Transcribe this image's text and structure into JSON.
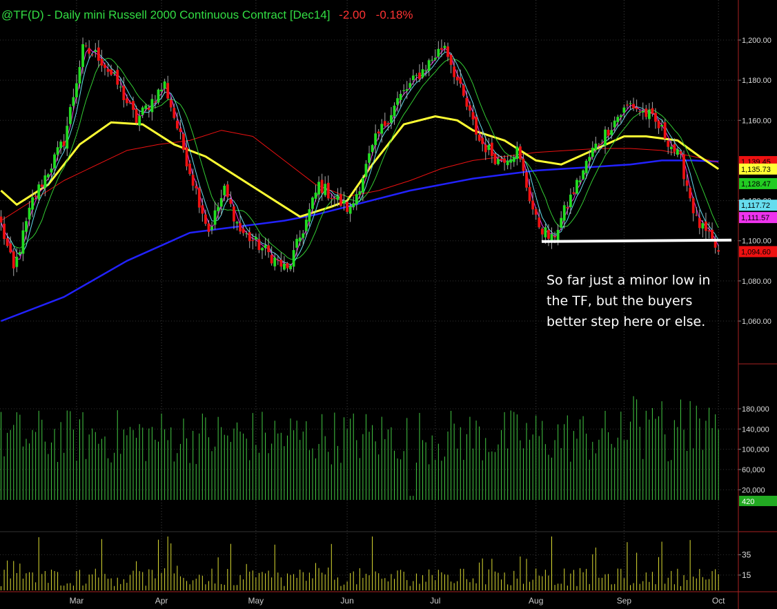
{
  "title": {
    "symbol_text": "@TF(D) - Daily  mini Russell 2000 Continuous Contract [Dec14]",
    "change": "-2.00",
    "change_pct": "-0.18%"
  },
  "annotation": {
    "lines": [
      "So far just a minor low in",
      "the TF, but the buyers",
      "better step here or else."
    ]
  },
  "colors": {
    "background": "#000000",
    "up_candle": "#22dd22",
    "down_candle": "#ee1111",
    "ma_yellow": "#ffff33",
    "ma_blue": "#2222ff",
    "ma_red": "#dd2222",
    "ma_green": "#33cc33",
    "ma_cyan": "#66ddee",
    "ma_magenta": "#ee33ee",
    "volume": "#44cc44",
    "osc": "#dddd33",
    "support": "#ffffff"
  },
  "chart_data": [
    {
      "type": "candlestick",
      "name": "price",
      "ylim": [
        1060,
        1200
      ],
      "yticks": [
        "1,200.00",
        "1,180.00",
        "1,160.00",
        "1,120.00",
        "1,100.00",
        "1,080.00",
        "1,060.00"
      ],
      "ytick_values": [
        1200,
        1180,
        1160,
        1120,
        1100,
        1080,
        1060
      ],
      "months": [
        "Mar",
        "Apr",
        "May",
        "Jun",
        "Jul",
        "Aug",
        "Sep",
        "Oct"
      ],
      "month_days": [
        24,
        51,
        81,
        110,
        138,
        170,
        198,
        228
      ],
      "support_level": 1100,
      "price_labels": [
        {
          "text": "1,139.45",
          "value": 1139.45,
          "bg": "#ee1111",
          "fg": "#000000"
        },
        {
          "text": "1,135.73",
          "value": 1135.73,
          "bg": "#ffff33",
          "fg": "#000000"
        },
        {
          "text": "1,128.47",
          "value": 1128.47,
          "bg": "#22cc22",
          "fg": "#000000"
        },
        {
          "text": "1,117.72",
          "value": 1117.72,
          "bg": "#66ddee",
          "fg": "#000000"
        },
        {
          "text": "1,111.57",
          "value": 1111.57,
          "bg": "#ee33ee",
          "fg": "#000000"
        },
        {
          "text": "1,094.60",
          "value": 1094.6,
          "bg": "#ee1111",
          "fg": "#000000"
        }
      ],
      "anchor_days": [
        0,
        4,
        10,
        20,
        26,
        31,
        37,
        43,
        52,
        60,
        66,
        71,
        76,
        84,
        91,
        97,
        101,
        107,
        111,
        119,
        126,
        134,
        141,
        146,
        152,
        158,
        164,
        170,
        175,
        180,
        188,
        196,
        200,
        206,
        210,
        216,
        221,
        228
      ],
      "anchor_closes": [
        1108,
        1085,
        1120,
        1150,
        1195,
        1192,
        1178,
        1160,
        1178,
        1135,
        1105,
        1125,
        1105,
        1095,
        1085,
        1110,
        1128,
        1120,
        1115,
        1150,
        1170,
        1185,
        1198,
        1175,
        1150,
        1140,
        1145,
        1110,
        1100,
        1118,
        1145,
        1162,
        1168,
        1162,
        1155,
        1140,
        1110,
        1094.6
      ],
      "moving_averages": [
        {
          "name": "200",
          "color": "#2222ff",
          "days": [
            0,
            20,
            40,
            60,
            70,
            80,
            90,
            100,
            110,
            120,
            130,
            140,
            150,
            160,
            170,
            180,
            190,
            200,
            210,
            220,
            228
          ],
          "values": [
            1060,
            1072,
            1090,
            1104,
            1106,
            1108,
            1110,
            1113,
            1117,
            1121,
            1125,
            1128,
            1131,
            1133,
            1135,
            1136,
            1137,
            1138,
            1140,
            1140,
            1139.45
          ]
        },
        {
          "name": "50",
          "color": "#ee1111",
          "days": [
            0,
            20,
            40,
            50,
            60,
            70,
            80,
            90,
            100,
            110,
            120,
            130,
            140,
            150,
            160,
            170,
            180,
            190,
            200,
            210,
            220,
            228
          ],
          "values": [
            1110,
            1130,
            1145,
            1148,
            1150,
            1155,
            1152,
            1140,
            1128,
            1122,
            1125,
            1130,
            1136,
            1140,
            1142,
            1144,
            1145,
            1146,
            1146,
            1145,
            1142,
            1139
          ]
        },
        {
          "name": "20",
          "color": "#ffff33",
          "days": [
            0,
            5,
            15,
            25,
            35,
            45,
            55,
            65,
            75,
            85,
            95,
            105,
            110,
            118,
            128,
            138,
            145,
            150,
            160,
            170,
            178,
            188,
            198,
            205,
            215,
            222,
            228
          ],
          "values": [
            1125,
            1118,
            1128,
            1148,
            1159,
            1158,
            1148,
            1142,
            1132,
            1122,
            1112,
            1117,
            1120,
            1138,
            1158,
            1162,
            1160,
            1155,
            1150,
            1140,
            1138,
            1145,
            1152,
            1152,
            1150,
            1142,
            1135.73
          ]
        }
      ]
    },
    {
      "type": "bar",
      "name": "volume",
      "yticks": [
        "180,000",
        "140,000",
        "100,000",
        "60,000",
        "20,000"
      ],
      "ytick_values": [
        180000,
        140000,
        100000,
        60000,
        20000
      ],
      "ylim": [
        0,
        220000
      ],
      "last_label": "420"
    },
    {
      "type": "bar",
      "name": "oscillator",
      "yticks": [
        "35",
        "15"
      ],
      "ytick_values": [
        35,
        15
      ],
      "ylim": [
        0,
        50
      ]
    }
  ]
}
